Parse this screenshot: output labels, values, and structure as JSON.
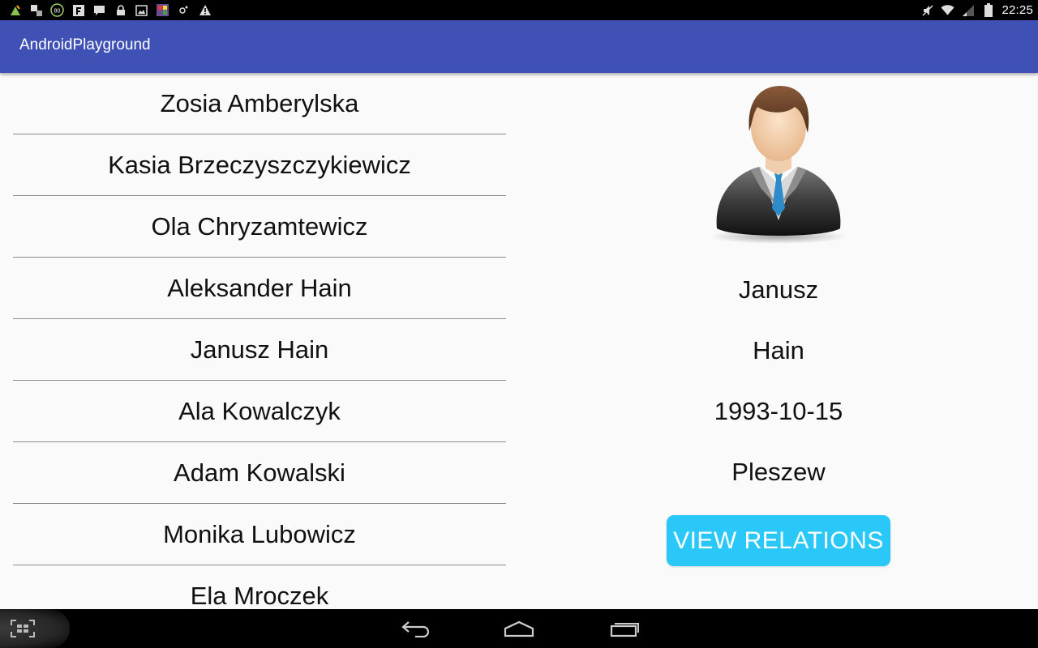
{
  "status_bar": {
    "time": "22:25",
    "notification_icons": [
      "app-icon",
      "dual-square-icon",
      "badge-80-icon",
      "flipboard-icon",
      "chat-icon",
      "lock-icon",
      "image-icon",
      "game-icon",
      "settings-icon",
      "warning-icon"
    ],
    "badge_text": "80",
    "system_icons": [
      "mute-icon",
      "wifi-icon",
      "signal-icon",
      "battery-icon"
    ]
  },
  "app_bar": {
    "title": "AndroidPlayground",
    "color": "#3f51b5"
  },
  "people_list": [
    {
      "name": "Zosia Amberylska"
    },
    {
      "name": "Kasia Brzeczyszczykiewicz"
    },
    {
      "name": "Ola Chryzamtewicz"
    },
    {
      "name": "Aleksander Hain"
    },
    {
      "name": "Janusz Hain"
    },
    {
      "name": "Ala Kowalczyk"
    },
    {
      "name": "Adam Kowalski"
    },
    {
      "name": "Monika Lubowicz"
    },
    {
      "name": "Ela Mroczek"
    }
  ],
  "detail": {
    "avatar_icon": "person-avatar-icon",
    "first_name": "Janusz",
    "last_name": "Hain",
    "birth_date": "1993-10-15",
    "city": "Pleszew",
    "relations_button_label": "VIEW RELATIONS",
    "button_color": "#29c8f8"
  },
  "nav_bar": {
    "icons": [
      "back-icon",
      "home-icon",
      "recents-icon",
      "screenshot-icon"
    ]
  }
}
